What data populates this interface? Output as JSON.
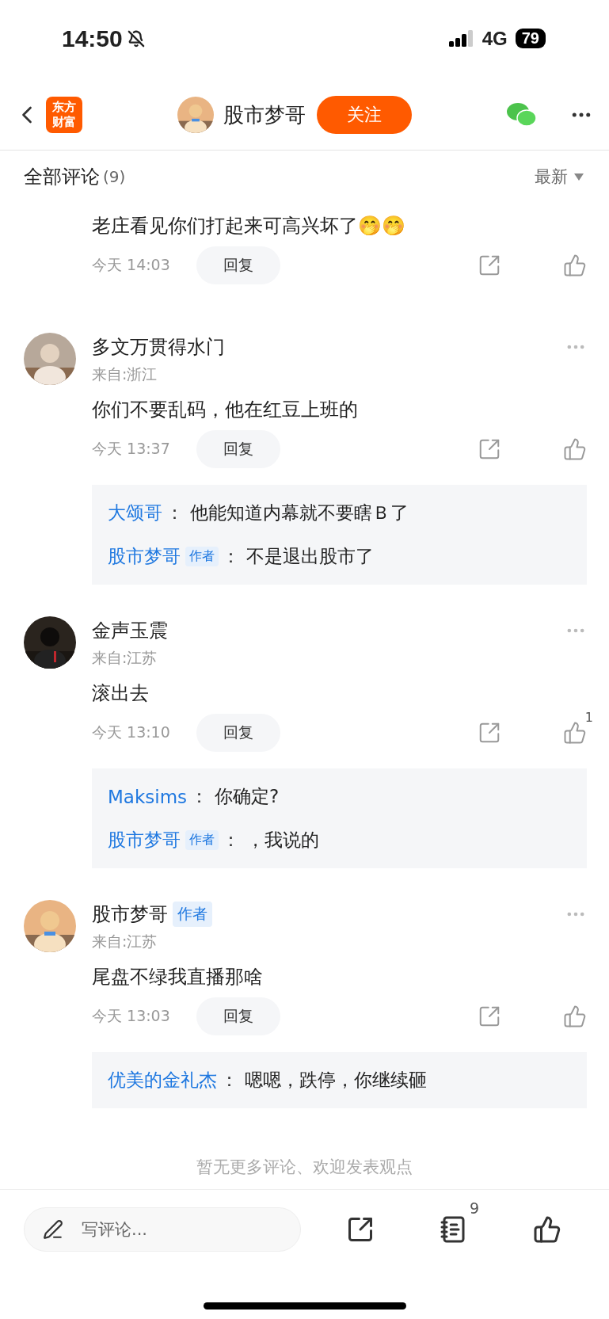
{
  "status_bar": {
    "time": "14:50",
    "network": "4G",
    "battery": "79"
  },
  "nav": {
    "logo_lines": [
      "东方",
      "财富"
    ],
    "title": "股市梦哥",
    "follow_button": "关注"
  },
  "comments_header": {
    "title": "全部评论",
    "count": "(9)",
    "sort": "最新"
  },
  "comments": [
    {
      "kind": "partial",
      "text": "老庄看见你们打起来可高兴坏了🤭🤭",
      "time": "今天 14:03",
      "reply_button": "回复"
    },
    {
      "kind": "full",
      "name": "多文万贯得水门",
      "location": "来自:浙江",
      "text": "你们不要乱码，他在红豆上班的",
      "time": "今天 13:37",
      "reply_button": "回复",
      "replies": [
        {
          "user": "大颂哥",
          "colon": "：",
          "text": "他能知道内幕就不要瞎Ｂ了"
        },
        {
          "user": "股市梦哥",
          "author_badge": "作者",
          "colon": "：",
          "text": "不是退出股市了"
        }
      ]
    },
    {
      "kind": "full",
      "name": "金声玉震",
      "location": "来自:江苏",
      "text": "滚出去",
      "time": "今天 13:10",
      "reply_button": "回复",
      "likes": "1",
      "replies": [
        {
          "user": "Maksims",
          "colon": "：",
          "text": "你确定?"
        },
        {
          "user": "股市梦哥",
          "author_badge": "作者",
          "colon": "：",
          "text": "，我说的"
        }
      ]
    },
    {
      "kind": "full",
      "name": "股市梦哥",
      "author_badge": "作者",
      "location": "来自:江苏",
      "text": "尾盘不绿我直播那啥",
      "time": "今天 13:03",
      "reply_button": "回复",
      "replies": [
        {
          "user": "优美的金礼杰",
          "colon": "：",
          "text": "嗯嗯，跌停，你继续砸"
        }
      ]
    }
  ],
  "footer_note": "暂无更多评论、欢迎发表观点",
  "bottom_bar": {
    "placeholder": "写评论...",
    "comment_count": "9"
  }
}
